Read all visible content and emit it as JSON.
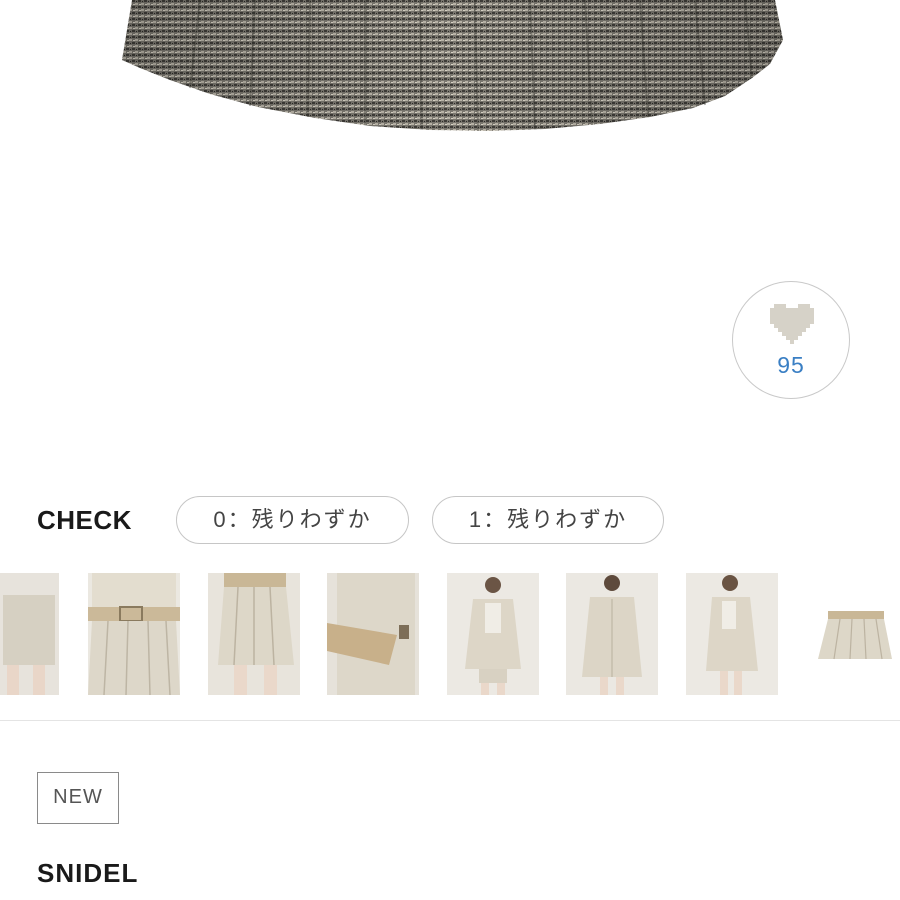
{
  "product_image": {
    "alt": ""
  },
  "like": {
    "icon": "heart-icon",
    "count": "95",
    "count_color": "#3a7fc4"
  },
  "color_selector": {
    "label": "CHECK",
    "options": [
      {
        "label": "0：残りわずか"
      },
      {
        "label": "1：残りわずか"
      }
    ]
  },
  "thumbnails": [
    {
      "name": "thumbnail-1"
    },
    {
      "name": "thumbnail-2"
    },
    {
      "name": "thumbnail-3"
    },
    {
      "name": "thumbnail-4"
    },
    {
      "name": "thumbnail-5"
    },
    {
      "name": "thumbnail-6"
    },
    {
      "name": "thumbnail-7"
    },
    {
      "name": "thumbnail-8"
    }
  ],
  "product": {
    "badge": "NEW",
    "brand": "SNIDEL"
  }
}
